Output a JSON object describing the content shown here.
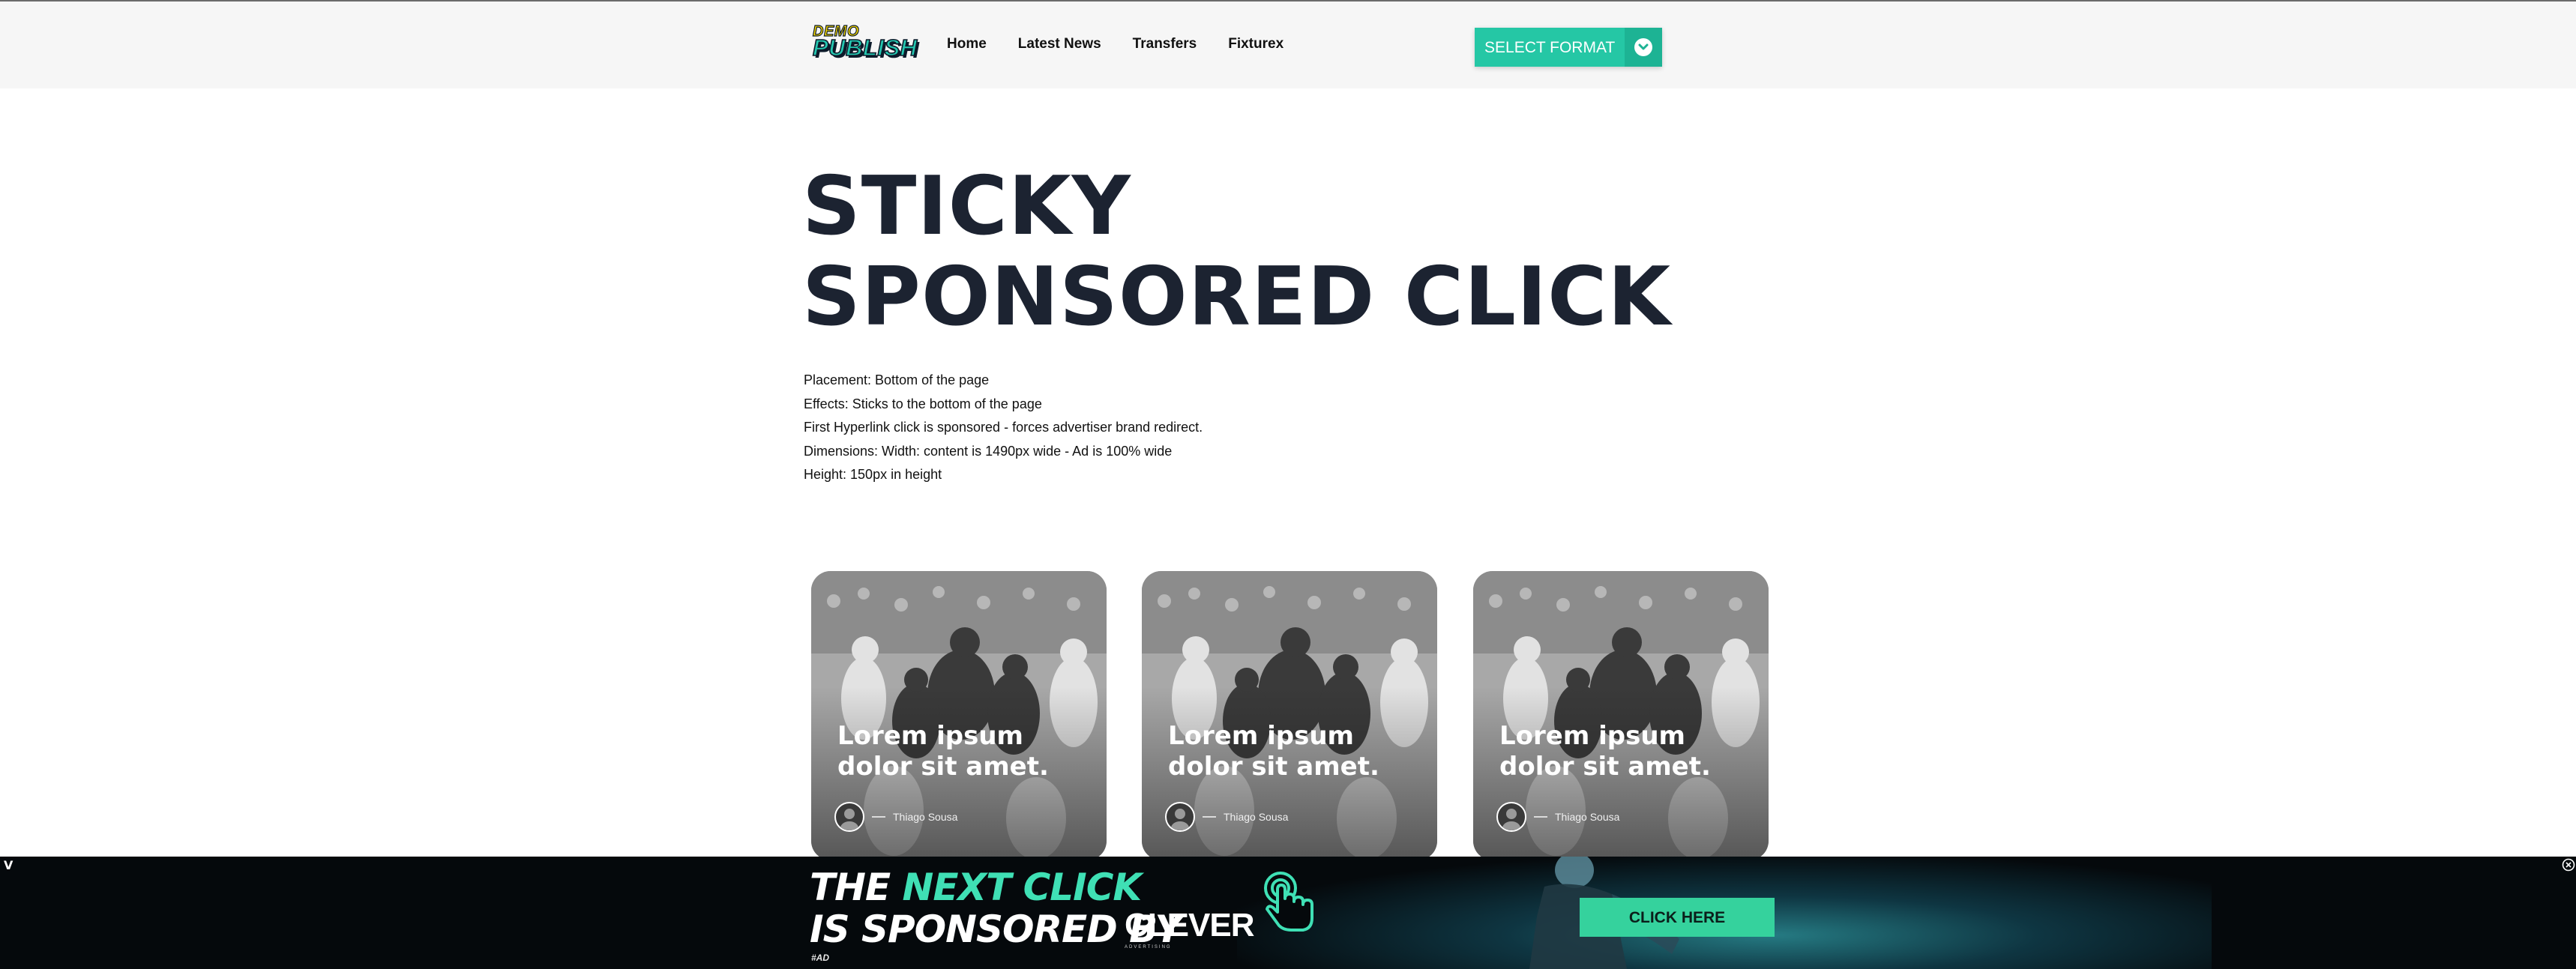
{
  "header": {
    "logo_top": "DEMO",
    "logo_main": "PUBLISH",
    "nav": [
      "Home",
      "Latest News",
      "Transfers",
      "Fixturex"
    ],
    "format_select": {
      "label": "SELECT FORMAT",
      "icon": "chevron-down-icon"
    }
  },
  "page": {
    "title": "STICKY SPONSORED CLICK",
    "specs": [
      "Placement: Bottom of the page",
      "Effects: Sticks to the bottom of the page",
      "First Hyperlink click is sponsored - forces advertiser brand redirect.",
      "Dimensions: Width: content is 1490px wide - Ad is 100% wide",
      "Height: 150px in height"
    ]
  },
  "cards": [
    {
      "title": "Lorem ipsum dolor sit amet.",
      "author": "Thiago Sousa"
    },
    {
      "title": "Lorem ipsum dolor sit amet.",
      "author": "Thiago Sousa"
    },
    {
      "title": "Lorem ipsum dolor sit amet.",
      "author": "Thiago Sousa"
    }
  ],
  "ad": {
    "toggle": "V",
    "line1_start": "THE ",
    "line1_accent": "NEXT CLICK",
    "line2": "IS SPONSORED BY",
    "brand": "CLEVER",
    "brand_sub": "ADVERTISING",
    "tag": "#AD",
    "cta": "CLICK HERE",
    "accent_color": "#3fe0b5"
  },
  "colors": {
    "brand_teal": "#25c7a5",
    "title_navy": "#1c2331",
    "header_bg": "#f6f6f6",
    "cta_green": "#35d29d"
  }
}
